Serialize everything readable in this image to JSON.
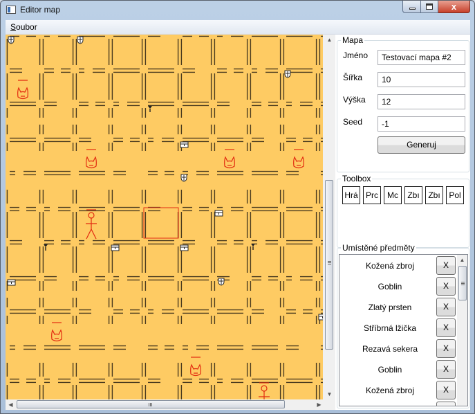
{
  "window": {
    "title": "Editor map",
    "close_label": "x"
  },
  "menu": {
    "file_label": "Soubor",
    "file_accesskey": "S",
    "file_rest": "oubor"
  },
  "colors": {
    "map_bg": "#fecb63",
    "wall": "#4a3b1f",
    "marker": "#e22b10"
  },
  "icons": {
    "shield": "shield-icon",
    "chest": "chest-icon",
    "ring": "ring-icon",
    "goblin": "goblin-icon",
    "player": "player-icon"
  },
  "map_group": {
    "title": "Mapa",
    "name_label": "Jméno",
    "name_value": "Testovací mapa #2",
    "width_label": "Šířka",
    "width_value": "10",
    "height_label": "Výška",
    "height_value": "12",
    "seed_label": "Seed",
    "seed_value": "-1",
    "generate_label": "Generuj"
  },
  "toolbox": {
    "title": "Toolbox",
    "tools": [
      "Hrá",
      "Prc",
      "Mc",
      "Zbı",
      "Zbı",
      "Pol"
    ]
  },
  "placed": {
    "title": "Umístěné předměty",
    "remove_label": "X",
    "items": [
      "Kožená zbroj",
      "Goblin",
      "Zlatý prsten",
      "Stříbrná lžička",
      "Rezavá sekera",
      "Goblin",
      "Kožená zbroj"
    ]
  }
}
